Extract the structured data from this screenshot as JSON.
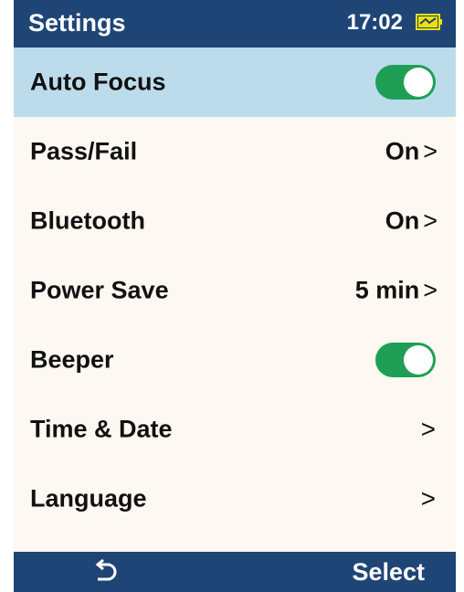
{
  "header": {
    "title": "Settings",
    "time": "17:02",
    "battery_icon": "battery-charging-icon"
  },
  "items": [
    {
      "label": "Auto Focus",
      "type": "toggle",
      "state": "on",
      "selected": true
    },
    {
      "label": "Pass/Fail",
      "type": "value",
      "value": "On"
    },
    {
      "label": "Bluetooth",
      "type": "value",
      "value": "On"
    },
    {
      "label": "Power Save",
      "type": "value",
      "value": "5 min"
    },
    {
      "label": "Beeper",
      "type": "toggle",
      "state": "on"
    },
    {
      "label": "Time & Date",
      "type": "link"
    },
    {
      "label": "Language",
      "type": "link"
    }
  ],
  "chevron": ">",
  "footer": {
    "back_icon": "back-arrow-icon",
    "select_label": "Select"
  },
  "colors": {
    "bar": "#1f4577",
    "background": "#fdf8f1",
    "selected_row": "#bcdcec",
    "toggle_on": "#1f9f55",
    "battery": "#f2e100"
  }
}
